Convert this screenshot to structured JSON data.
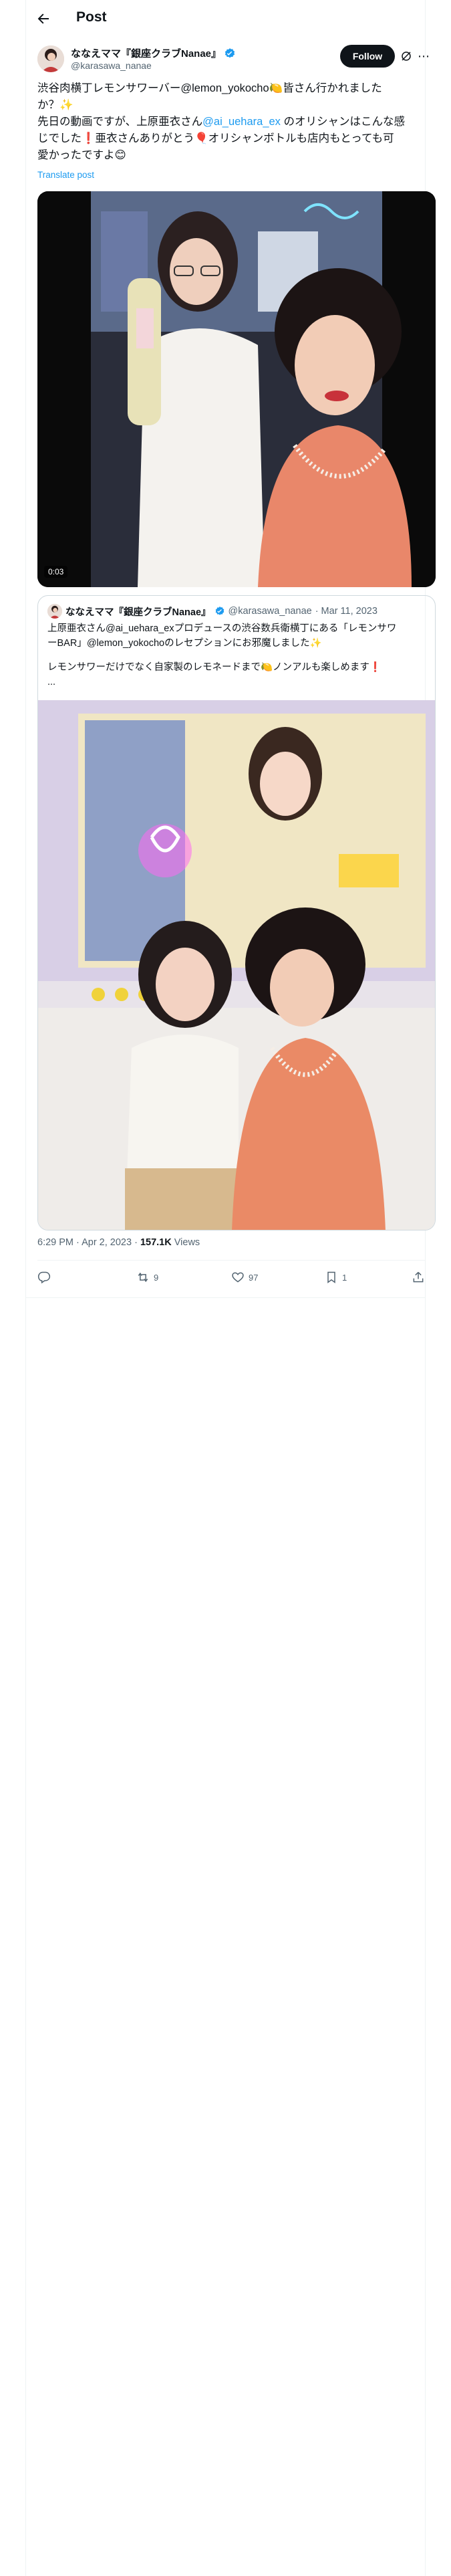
{
  "header": {
    "title": "Post"
  },
  "author": {
    "name": "ななえママ『銀座クラブNanae』",
    "handle": "@karasawa_nanae",
    "follow_label": "Follow"
  },
  "post": {
    "line1": "渋谷肉横丁レモンサワーバー@lemon_yokocho🍋皆さん行かれました",
    "line2": "か？✨",
    "line3": "先日の動画ですが、上原亜衣さん",
    "mention": "@ai_uehara_ex",
    "line3_rest": " のオリシャンはこんな感",
    "line4": "じでした❗️亜衣さんありがとう🎈オリシャンボトルも店内もとっても可",
    "line5": "愛かったですよ😊",
    "translate": "Translate post",
    "video_time": "0:03"
  },
  "quote": {
    "name": "ななえママ『銀座クラブNanae』",
    "handle": "@karasawa_nanae",
    "date": "· Mar 11, 2023",
    "line1": "上原亜衣さん@ai_uehara_exプロデュースの渋谷数兵衛横丁にある「レモンサワ",
    "line2": "ーBAR」@lemon_yokochoのレセプションにお邪魔しました✨",
    "line3": "レモンサワーだけでなく自家製のレモネードまで🍋ノンアルも楽しめます❗️",
    "line4": "..."
  },
  "meta": {
    "time": "6:29 PM · Apr 2, 2023 · ",
    "views_count": "157.1K",
    "views_label": " Views"
  },
  "actions": {
    "reposts": "9",
    "likes": "97",
    "bookmarks": "1"
  },
  "colors": {
    "accent": "#1d9bf0",
    "verified": "#1d9bf0",
    "button": "#0f1419"
  }
}
